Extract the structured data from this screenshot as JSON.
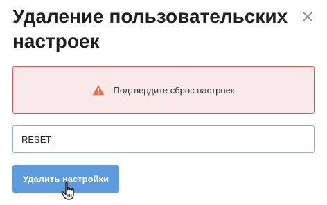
{
  "dialog": {
    "title": "Удаление пользовательских настроек",
    "close_icon": "close-icon"
  },
  "alert": {
    "icon": "warning-icon",
    "text": "Подтвердите сброс настроек",
    "colors": {
      "background": "#f9e9e8",
      "border": "#d9534f",
      "icon": "#e8704e"
    }
  },
  "confirm_input": {
    "value": "RESET"
  },
  "submit": {
    "label": "Удалить настройки",
    "color": "#5b9bde"
  },
  "pointer": {
    "icon": "hand-pointer-icon"
  }
}
